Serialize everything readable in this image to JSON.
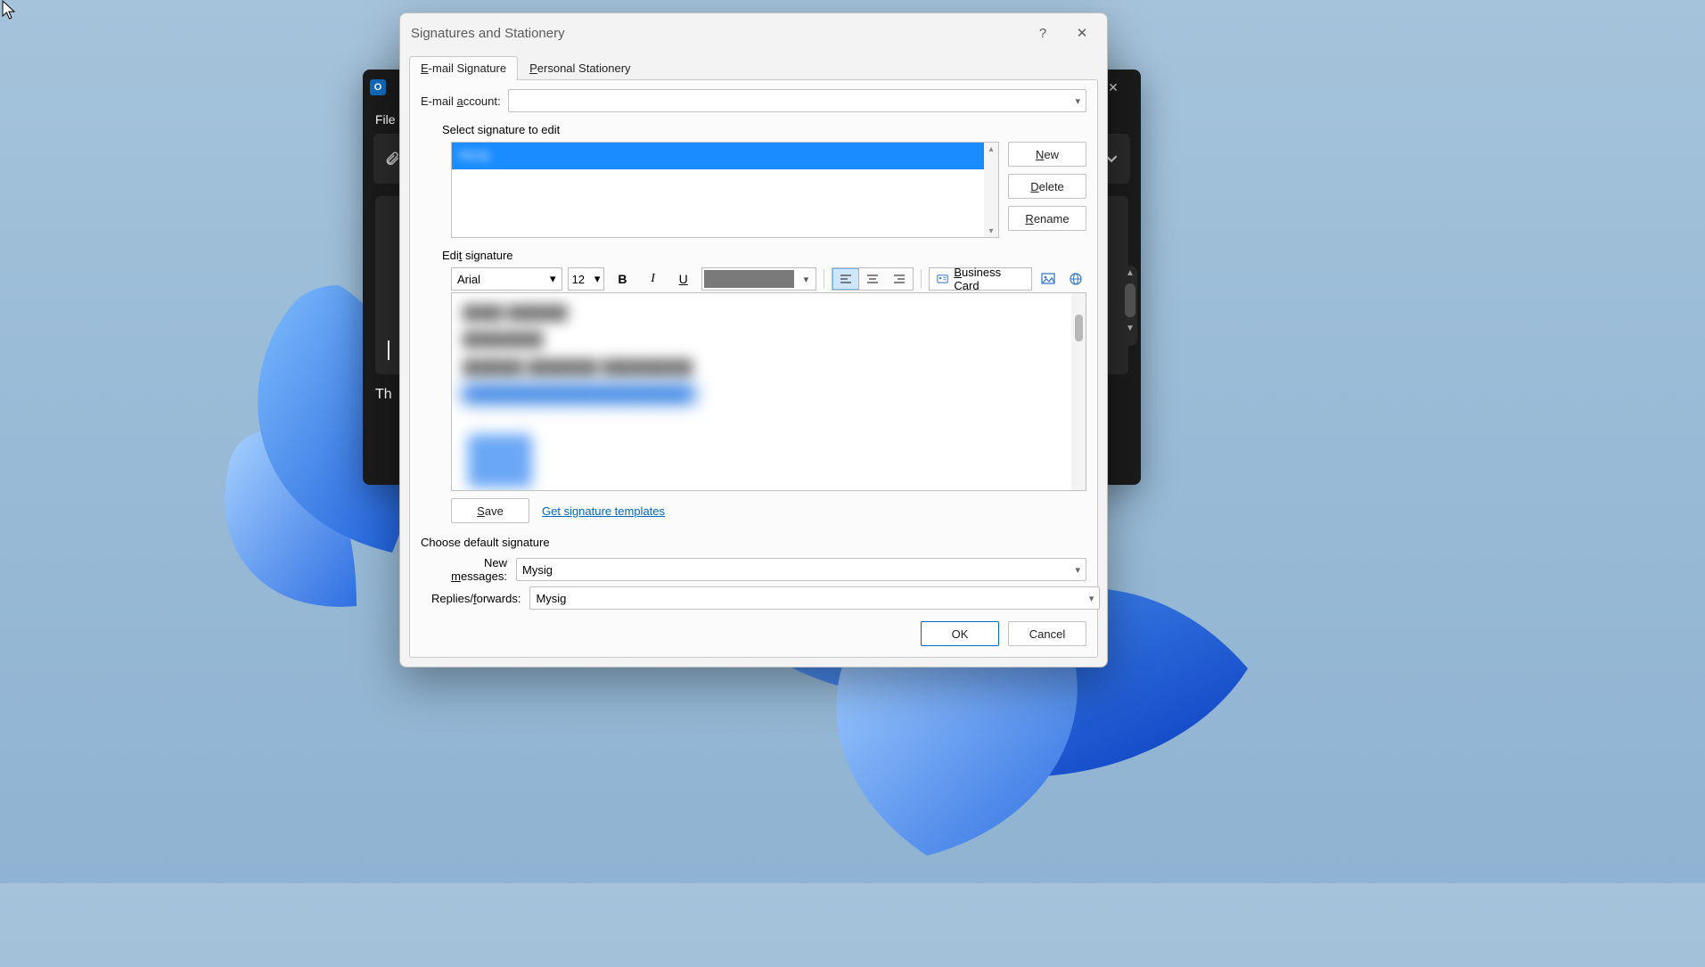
{
  "dialog": {
    "title": "Signatures and Stationery",
    "help": "?",
    "close": "✕",
    "tabs": {
      "email": "E-mail Signature",
      "stationery": "Personal Stationery"
    },
    "email_account_label": "E-mail account:",
    "email_account_value": "",
    "select_sig_label": "Select signature to edit",
    "sig_list_selected": "Mysig",
    "buttons": {
      "new": "New",
      "delete": "Delete",
      "rename": "Rename",
      "save": "Save",
      "ok": "OK",
      "cancel": "Cancel"
    },
    "edit_sig_label": "Edit signature",
    "toolbar": {
      "font": "Arial",
      "size": "12",
      "business_card": "Business Card"
    },
    "templates_link": "Get signature templates",
    "choose_default_label": "Choose default signature",
    "new_messages_label": "New messages:",
    "replies_label": "Replies/forwards:",
    "new_messages_value": "Mysig",
    "replies_value": "Mysig"
  },
  "outlook": {
    "file": "File",
    "body_prefix": "Th"
  }
}
